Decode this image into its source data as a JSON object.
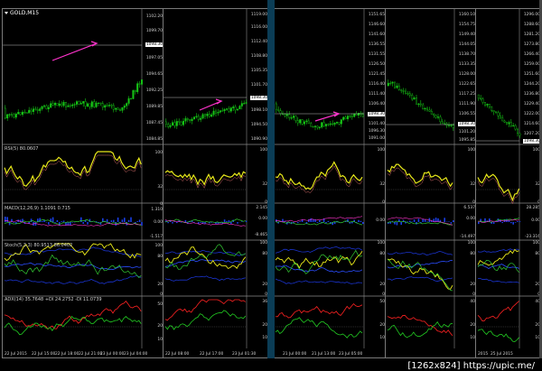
{
  "panel1": {
    "symbol": "GOLD,M15",
    "ind_rsi": "RSI(5) 80.0607",
    "ind_macd": "MACD(12,26,9) 1.1091 0.715",
    "ind_stoch": "Stoch(5,3,3) 80.9513 86.0402",
    "ind_adx": "ADX(14) 35.7648 +DI 24.2752 -DI 11.0739",
    "prices": [
      "1102.20",
      "1099.70",
      "1097.05",
      "1094.65",
      "1092.25",
      "1089.85",
      "1087.45",
      "1084.85"
    ],
    "price_box": "1098.30",
    "times": [
      "22 Jul 2015",
      "22 Jul 15:00",
      "22 Jul 18:00",
      "22 Jul 21:00",
      "23 Jul 00:00",
      "23 Jul 04:00"
    ],
    "rsi_scale": [
      "100",
      "32",
      "0"
    ],
    "macd_scale": [
      "1.310",
      "0.00",
      "-1.517"
    ],
    "stoch_scale": [
      "100",
      "80",
      "20",
      "0"
    ],
    "adx_scale": [
      "50",
      "20",
      "10"
    ]
  },
  "panel2": {
    "prices": [
      "1119.00",
      "1116.00",
      "1112.40",
      "1108.80",
      "1105.35",
      "1101.70",
      "1098.10",
      "1094.50",
      "1090.90"
    ],
    "price_box": "1098.30",
    "times": [
      "22 Jul 08:00",
      "22 Jul 17:00",
      "23 Jul 01:30"
    ],
    "rsi_scale": [
      "100",
      "32",
      "0"
    ],
    "macd_scale": [
      "2.145",
      "0.00",
      "-8.465"
    ],
    "stoch_scale": [
      "100",
      "80",
      "20",
      "0"
    ],
    "adx_scale": [
      "36",
      "20",
      "10"
    ]
  },
  "panel3": {
    "prices": [
      "1151.65",
      "1146.60",
      "1141.60",
      "1136.55",
      "1131.55",
      "1126.50",
      "1121.45",
      "1116.40",
      "1111.40",
      "1106.40",
      "1101.40",
      "1096.30",
      "1091.00"
    ],
    "price_box": "1098.30",
    "times": [
      "21 Jul 00:00",
      "21 Jul 13:00",
      "23 Jul 05:00"
    ],
    "rsi_scale": [
      "100",
      "32",
      "0"
    ],
    "macd_scale": [
      "0.00"
    ],
    "stoch_scale": [
      "100",
      "80",
      "20",
      "0"
    ],
    "adx_scale": [
      "50",
      "20",
      "10"
    ]
  },
  "panel4": {
    "prices": [
      "1160.10",
      "1154.75",
      "1149.40",
      "1144.05",
      "1138.70",
      "1133.35",
      "1128.00",
      "1122.65",
      "1117.25",
      "1111.90",
      "1106.55",
      "1101.20",
      "1095.85"
    ],
    "price_box": "1098.30",
    "times": [],
    "rsi_scale": [
      "100",
      "32",
      "0"
    ],
    "macd_scale": [
      "6.537",
      "0.00",
      "-14.497"
    ],
    "stoch_scale": [
      "100",
      "80",
      "20",
      "0"
    ],
    "adx_scale": [
      "40",
      "20",
      "10"
    ]
  },
  "panel5": {
    "prices": [
      "1296.00",
      "1288.60",
      "1281.20",
      "1273.80",
      "1266.40",
      "1259.00",
      "1251.60",
      "1244.20",
      "1236.80",
      "1229.40",
      "1222.00",
      "1214.60",
      "1207.20"
    ],
    "price_box": "1098.30",
    "times": [
      "2015",
      "25 Jul 2015"
    ],
    "rsi_scale": [
      "100",
      "32",
      "0"
    ],
    "macd_scale": [
      "28.285",
      "0.00",
      "-23.316"
    ],
    "stoch_scale": [
      "100",
      "80",
      "20",
      "0"
    ],
    "adx_scale": [
      "40",
      "20",
      "10"
    ]
  },
  "watermark": "[1262x824] https://upic.me/"
}
